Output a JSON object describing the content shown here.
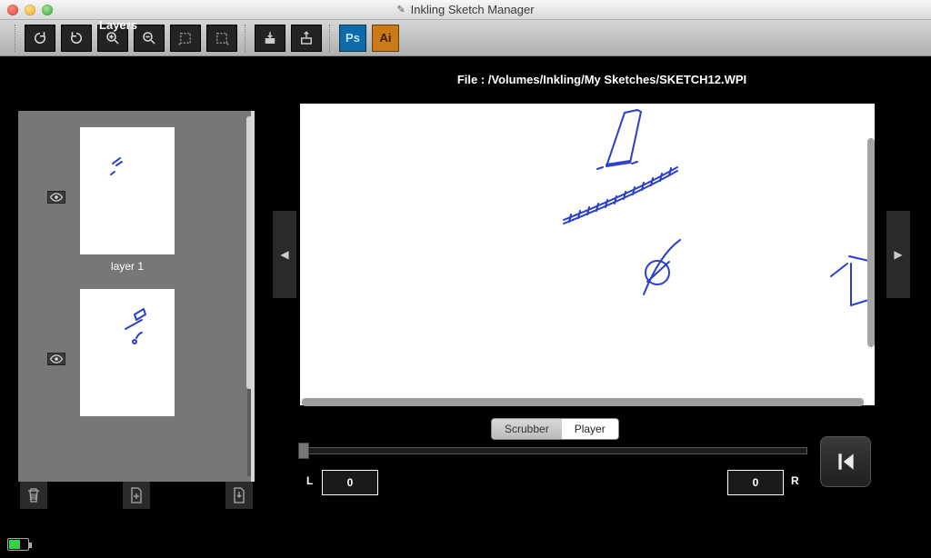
{
  "window": {
    "title": "Inkling Sketch Manager"
  },
  "toolbar": {
    "buttons": [
      "rotate-cw",
      "rotate-ccw",
      "zoom-in",
      "zoom-out",
      "crop-start",
      "crop-end",
      "import",
      "export",
      "ps",
      "ai"
    ]
  },
  "layers": {
    "title": "Layers",
    "items": [
      {
        "label": "layer 1",
        "visible": true
      },
      {
        "label": "",
        "visible": true
      }
    ]
  },
  "file": {
    "label_prefix": "File :",
    "path": "/Volumes/Inkling/My Sketches/SKETCH12.WPI"
  },
  "playback": {
    "tabs": {
      "scrubber": "Scrubber",
      "player": "Player",
      "active": "player"
    },
    "left_label": "L",
    "right_label": "R",
    "left_value": "0",
    "right_value": "0"
  }
}
